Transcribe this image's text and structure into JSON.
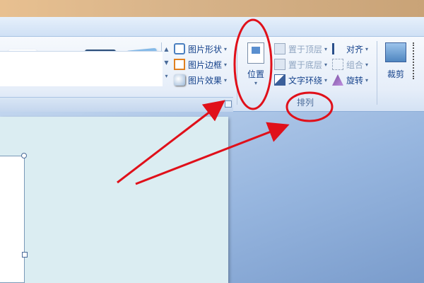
{
  "ribbon": {
    "picture_styles": {
      "commands": [
        {
          "label": "图片形状",
          "icon": "picture-shape-icon"
        },
        {
          "label": "图片边框",
          "icon": "picture-border-icon"
        },
        {
          "label": "图片效果",
          "icon": "picture-effects-icon"
        }
      ]
    },
    "arrange": {
      "position_label": "位置",
      "commands": [
        {
          "label": "置于顶层",
          "icon": "bring-to-front-icon",
          "disabled": true
        },
        {
          "label": "置于底层",
          "icon": "send-to-back-icon",
          "disabled": true
        },
        {
          "label": "文字环绕",
          "icon": "text-wrap-icon",
          "disabled": false
        }
      ],
      "commands_right": [
        {
          "label": "对齐",
          "icon": "align-icon",
          "disabled": false
        },
        {
          "label": "组合",
          "icon": "group-icon",
          "disabled": true
        },
        {
          "label": "旋转",
          "icon": "rotate-icon",
          "disabled": false
        }
      ],
      "group_label": "排列"
    },
    "size": {
      "crop_label": "裁剪"
    }
  },
  "colors": {
    "annotation": "#e0101a",
    "ribbon_text": "#15428b",
    "workspace": "#7a9ccc"
  }
}
